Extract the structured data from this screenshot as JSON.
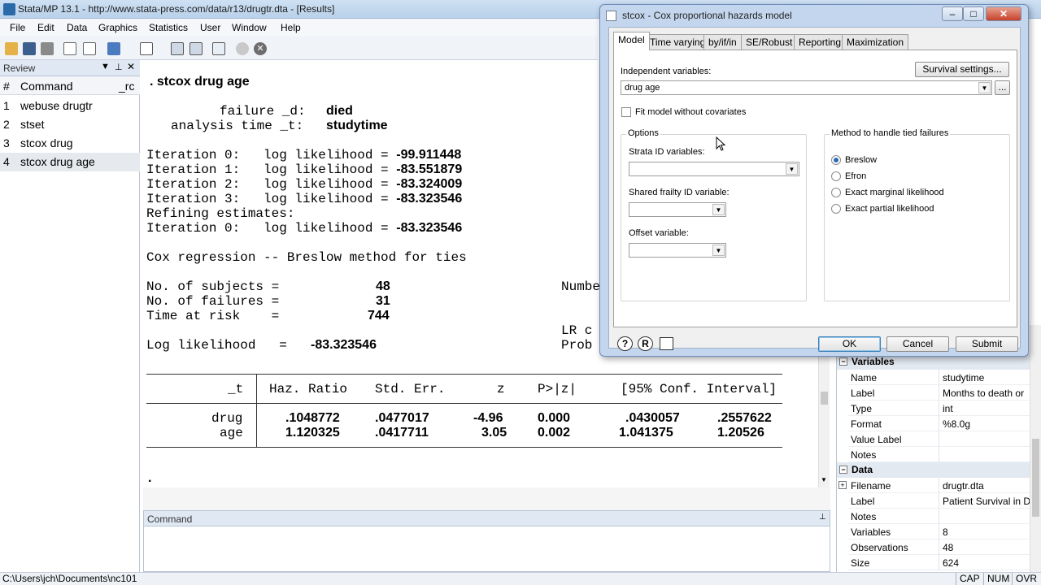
{
  "window": {
    "title": "Stata/MP 13.1 - http://www.stata-press.com/data/r13/drugtr.dta - [Results]"
  },
  "menu": [
    "File",
    "Edit",
    "Data",
    "Graphics",
    "Statistics",
    "User",
    "Window",
    "Help"
  ],
  "review": {
    "title": "Review",
    "col_num": "#",
    "col_command": "Command",
    "col_rc": "_rc",
    "rows": [
      {
        "n": "1",
        "cmd": "webuse drugtr"
      },
      {
        "n": "2",
        "cmd": "stset"
      },
      {
        "n": "3",
        "cmd": "stcox drug"
      },
      {
        "n": "4",
        "cmd": "stcox drug age"
      }
    ]
  },
  "results": {
    "command_line": ". stcox drug age",
    "failure_label": "failure _d:",
    "failure_value": "died",
    "analysis_label": "analysis time _t:",
    "analysis_value": "studytime",
    "iter_lines": [
      {
        "label": "Iteration 0:   log likelihood = ",
        "value": "-99.911448"
      },
      {
        "label": "Iteration 1:   log likelihood = ",
        "value": "-83.551879"
      },
      {
        "label": "Iteration 2:   log likelihood = ",
        "value": "-83.324009"
      },
      {
        "label": "Iteration 3:   log likelihood = ",
        "value": "-83.323546"
      }
    ],
    "refining": "Refining estimates:",
    "iter_final": {
      "label": "Iteration 0:   log likelihood = ",
      "value": "-83.323546"
    },
    "model_title": "Cox regression -- Breslow method for ties",
    "subjects_label": "No. of subjects =",
    "subjects_value": "48",
    "failures_label": "No. of failures =",
    "failures_value": "31",
    "risk_label": "Time at risk    =",
    "risk_value": "744",
    "ll_label": "Log likelihood   =",
    "ll_value": "-83.323546",
    "right_number": "Numbe",
    "right_lr": "LR c",
    "right_prob": "Prob",
    "table": {
      "head_t": "_t",
      "headers": [
        "Haz. Ratio",
        "Std. Err.",
        "z",
        "P>|z|",
        "[95% Conf. Interval]"
      ],
      "rows": [
        {
          "name": "drug",
          "vals": [
            ".1048772",
            ".0477017",
            "-4.96",
            "0.000",
            ".0430057",
            ".2557622"
          ]
        },
        {
          "name": "age",
          "vals": [
            "1.120325",
            ".0417711",
            "3.05",
            "0.002",
            "1.041375",
            "1.20526"
          ]
        }
      ]
    },
    "prompt": "."
  },
  "command_panel": {
    "title": "Command"
  },
  "properties": {
    "variables_header": "Variables",
    "var_rows": [
      {
        "k": "Name",
        "v": "studytime"
      },
      {
        "k": "Label",
        "v": "Months to death or"
      },
      {
        "k": "Type",
        "v": "int"
      },
      {
        "k": "Format",
        "v": "%8.0g"
      },
      {
        "k": "Value Label",
        "v": ""
      },
      {
        "k": "Notes",
        "v": ""
      }
    ],
    "data_header": "Data",
    "data_rows": [
      {
        "k": "Filename",
        "v": "drugtr.dta"
      },
      {
        "k": "Label",
        "v": "Patient Survival in D"
      },
      {
        "k": "Notes",
        "v": ""
      },
      {
        "k": "Variables",
        "v": "8"
      },
      {
        "k": "Observations",
        "v": "48"
      },
      {
        "k": "Size",
        "v": "624"
      }
    ]
  },
  "status": {
    "path": "C:\\Users\\jch\\Documents\\nc101",
    "indicators": [
      "CAP",
      "NUM",
      "OVR"
    ]
  },
  "dialog": {
    "title": "stcox - Cox proportional hazards model",
    "tabs": [
      "Model",
      "Time varying",
      "by/if/in",
      "SE/Robust",
      "Reporting",
      "Maximization"
    ],
    "indep_label": "Independent variables:",
    "indep_value": "drug age",
    "survival_button": "Survival settings...",
    "more_button": "...",
    "fit_label": "Fit model without covariates",
    "options_label": "Options",
    "strata_label": "Strata ID variables:",
    "frailty_label": "Shared frailty ID variable:",
    "offset_label": "Offset variable:",
    "ties_label": "Method to handle tied failures",
    "ties_options": [
      "Breslow",
      "Efron",
      "Exact marginal likelihood",
      "Exact partial likelihood"
    ],
    "ok": "OK",
    "cancel": "Cancel",
    "submit": "Submit",
    "help_icon": "?",
    "reset_icon": "R"
  }
}
